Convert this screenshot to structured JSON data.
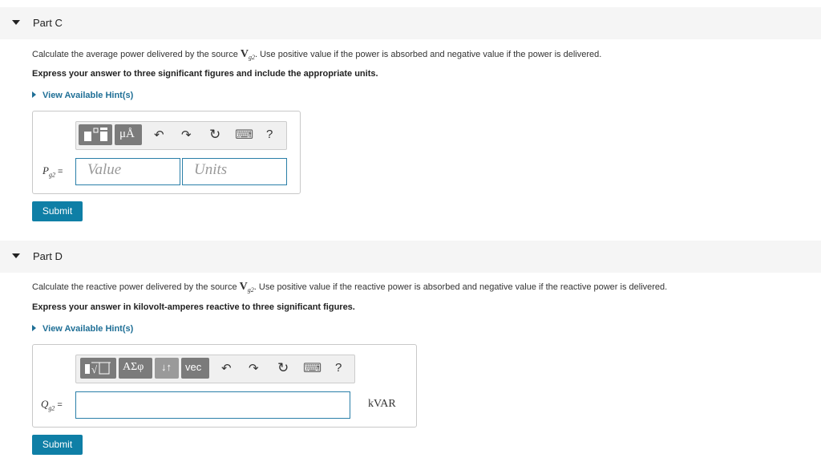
{
  "partC": {
    "title": "Part C",
    "question_pre": "Calculate the average power delivered by the source ",
    "question_var": "V",
    "question_sub": "g2",
    "question_post": ". Use positive value if the power is absorbed and negative value if the power is delivered.",
    "instruction": "Express your answer to three significant figures and include the appropriate units.",
    "hint": "View Available Hint(s)",
    "toolbar": {
      "templates_icon": "templates-icon",
      "units_label": "μÅ",
      "undo": "↶",
      "redo": "↷",
      "reset": "↻",
      "keyboard": "⌨",
      "help": "?"
    },
    "var_name": "P",
    "var_sub": "g2",
    "eq": "=",
    "value_placeholder": "Value",
    "units_placeholder": "Units",
    "submit": "Submit"
  },
  "partD": {
    "title": "Part D",
    "question_pre": "Calculate the reactive power delivered by the source ",
    "question_var": "V",
    "question_sub": "g2",
    "question_post": ". Use positive value if the reactive power is absorbed and negative value if the reactive power is delivered.",
    "instruction": "Express your answer in kilovolt-amperes reactive to three significant figures.",
    "hint": "View Available Hint(s)",
    "toolbar": {
      "greek_label": "ΑΣφ",
      "arrows_label": "↓↑",
      "vec_label": "vec",
      "undo": "↶",
      "redo": "↷",
      "reset": "↻",
      "keyboard": "⌨",
      "help": "?"
    },
    "var_name": "Q",
    "var_sub": "g2",
    "eq": "=",
    "answer_value": "",
    "unit": "kVAR",
    "submit": "Submit"
  },
  "colors": {
    "accent": "#0f7fa6",
    "link": "#1f6f96",
    "field_border": "#2a7fa8"
  }
}
